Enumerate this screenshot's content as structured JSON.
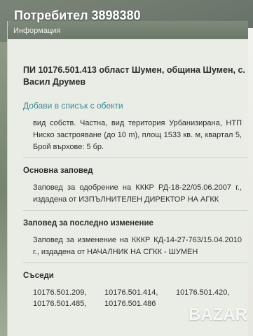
{
  "overlay": {
    "title": "Потребител 3898380",
    "logo": "BAZAR"
  },
  "panel": {
    "header": "Информация",
    "title": "ПИ 10176.501.413 област Шумен, община Шумен, с. Васил Друмев",
    "add_link": "Добави в списък с обекти",
    "description": "вид собств. Частна, вид територия Урбанизирана, НТП Ниско застрояване (до 10 m), площ 1533 кв. м, квартал 5, Брой върхове: 5 бр.",
    "sections": {
      "base_order_title": "Основна заповед",
      "base_order_text": "Заповед за одобрение на КККР РД-18-22/05.06.2007 г., издадена от ИЗПЪЛНИТЕЛЕН ДИРЕКТОР НА АГКК",
      "last_change_title": "Заповед за последно изменение",
      "last_change_text": "Заповед за изменение на КККР КД-14-27-763/15.04.2010 г., издадена от НАЧАЛНИК НА СГКК - ШУМЕН",
      "neighbors_title": "Съседи",
      "neighbors": [
        "10176.501.209,",
        "10176.501.414,",
        "10176.501.420,",
        "10176.501.485,",
        "10176.501.486"
      ]
    }
  }
}
